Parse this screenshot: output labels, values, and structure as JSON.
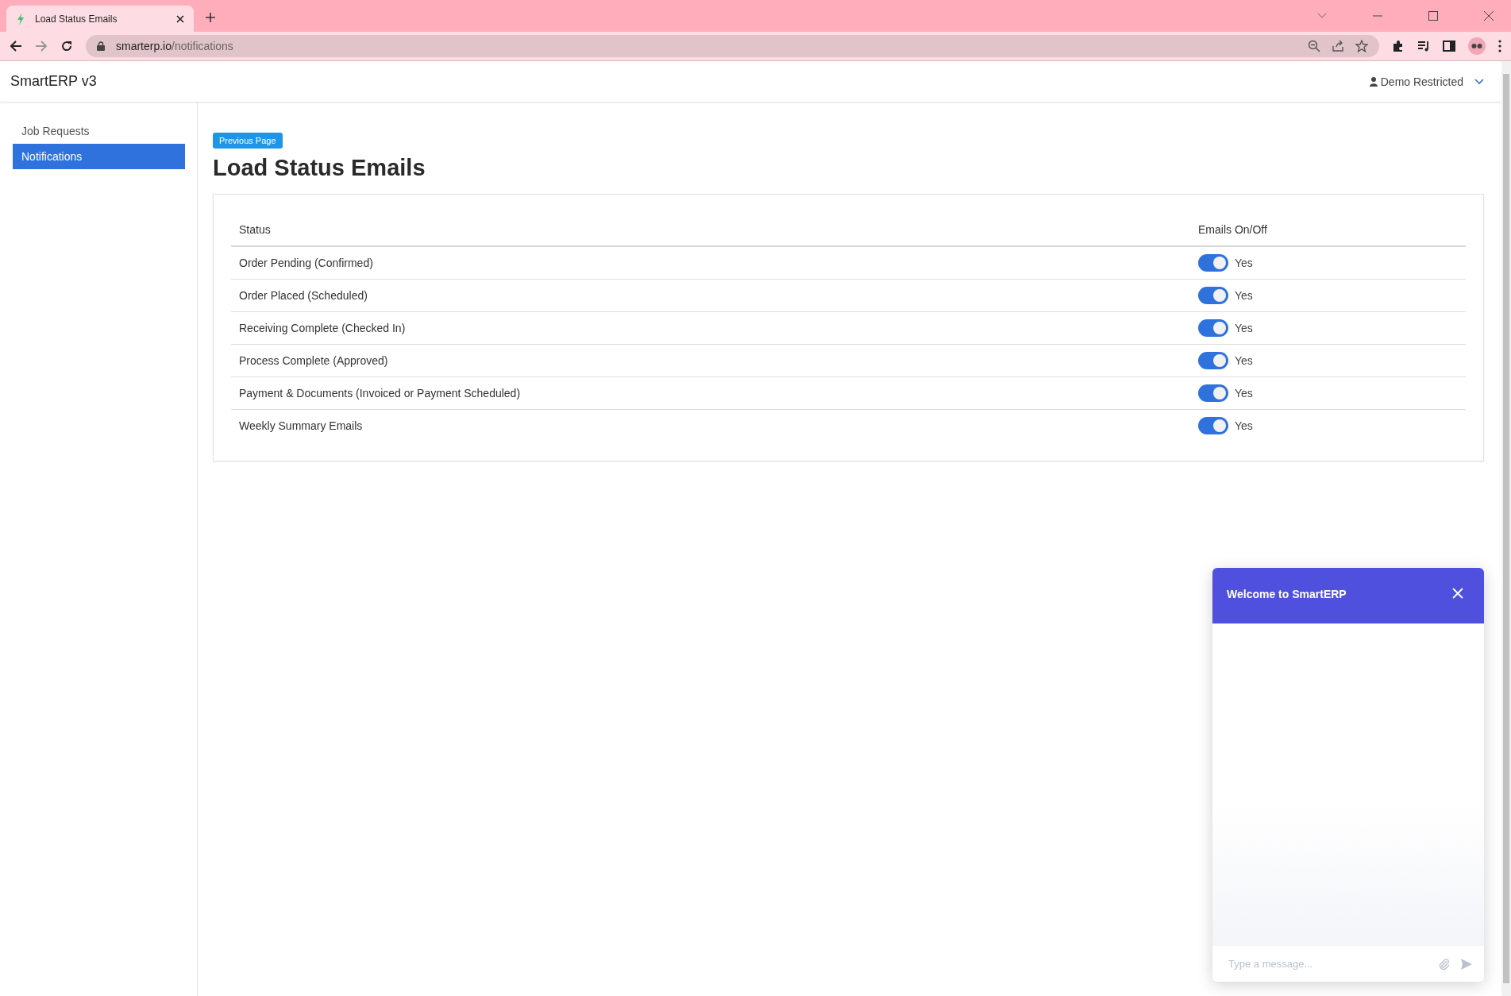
{
  "browser": {
    "tab_title": "Load Status Emails",
    "url_host": "smarterp.io",
    "url_path": "/notifications"
  },
  "header": {
    "brand": "SmartERP v3",
    "user": "Demo Restricted"
  },
  "sidebar": {
    "items": [
      {
        "label": "Job Requests",
        "selected": false
      },
      {
        "label": "Notifications",
        "selected": true
      }
    ]
  },
  "back_button": "Previous Page",
  "heading": "Load Status Emails",
  "table": {
    "columns": [
      "Status",
      "Emails On/Off"
    ],
    "rows": [
      {
        "status": "Order Pending (Confirmed)",
        "on": true,
        "reading": "Yes"
      },
      {
        "status": "Order Placed (Scheduled)",
        "on": true,
        "reading": "Yes"
      },
      {
        "status": "Receiving Complete (Checked In)",
        "on": true,
        "reading": "Yes"
      },
      {
        "status": "Process Complete (Approved)",
        "on": true,
        "reading": "Yes"
      },
      {
        "status": "Payment & Documents (Invoiced or Payment Scheduled)",
        "on": true,
        "reading": "Yes"
      },
      {
        "status": "Weekly Summary Emails",
        "on": true,
        "reading": "Yes"
      }
    ]
  },
  "chat": {
    "title": "Welcome to SmartERP",
    "placeholder": "Type a message..."
  }
}
